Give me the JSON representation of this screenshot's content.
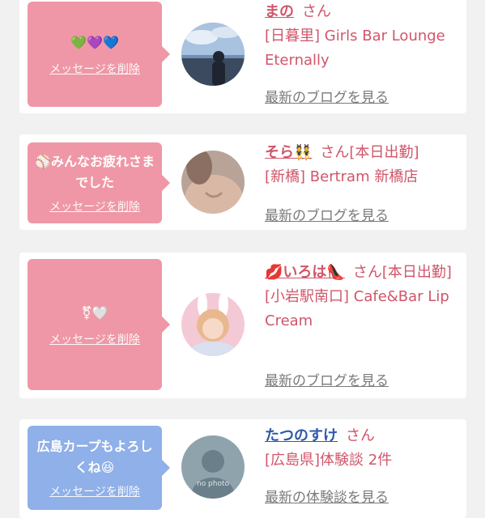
{
  "cards": [
    {
      "message": "💚💜💙",
      "delete_label": "メッセージを削除",
      "name": "まの",
      "suffix": "さん",
      "shop": "[日暮里] Girls Bar Lounge Eternally",
      "link": "最新のブログを見る",
      "bubble_color": "#ef97a6"
    },
    {
      "message": "⚾みんなお疲れさまでした",
      "delete_label": "メッセージを削除",
      "name": "そら👯",
      "suffix": "さん[本日出勤]",
      "shop": "[新橋] Bertram 新橋店",
      "link": "最新のブログを見る",
      "bubble_color": "#ef97a6"
    },
    {
      "message": "⚧🤍",
      "delete_label": "メッセージを削除",
      "name": "💋いろは👠",
      "suffix": "さん[本日出勤]",
      "shop": "[小岩駅南口] Cafe&Bar Lip Cream",
      "link": "最新のブログを見る",
      "bubble_color": "#ef97a6"
    },
    {
      "message": "広島カープもよろしくね😆",
      "delete_label": "メッセージを削除",
      "name": "たつのすけ",
      "suffix": "さん",
      "shop": "[広島県]体験談 2件",
      "link": "最新の体験談を見る",
      "avatar_text": "no photo",
      "bubble_color": "#8fb0e8"
    }
  ]
}
